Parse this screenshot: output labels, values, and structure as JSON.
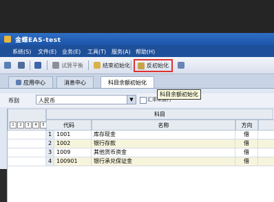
{
  "window": {
    "title": "金蝶EAS-test"
  },
  "menu": [
    "系统(S)",
    "文件(E)",
    "业务(E)",
    "工具(T)",
    "服务(A)",
    "帮助(H)"
  ],
  "toolbar": {
    "trial_balance": "试算平衡",
    "end_init": "结束初始化",
    "reverse_init": "反初始化"
  },
  "tabs": [
    "应用中心",
    "消息中心",
    "科目余额初始化"
  ],
  "tooltip": "科目余额初始化",
  "filter": {
    "currency_label": "币别",
    "currency_value": "人民币",
    "overlap_text": "汇率未运行"
  },
  "table": {
    "group_header": "科目",
    "columns": [
      "代码",
      "名称",
      "方向"
    ],
    "levels": [
      "1",
      "2",
      "3",
      "4",
      "5"
    ],
    "rows": [
      {
        "idx": "1",
        "code": "1001",
        "name": "库存现金",
        "dir": "借"
      },
      {
        "idx": "2",
        "code": "1002",
        "name": "银行存款",
        "dir": "借"
      },
      {
        "idx": "3",
        "code": "1009",
        "name": "其他货币资金",
        "dir": "借"
      },
      {
        "idx": "4",
        "code": "100901",
        "name": "银行承兑保证金",
        "dir": "借"
      }
    ]
  }
}
